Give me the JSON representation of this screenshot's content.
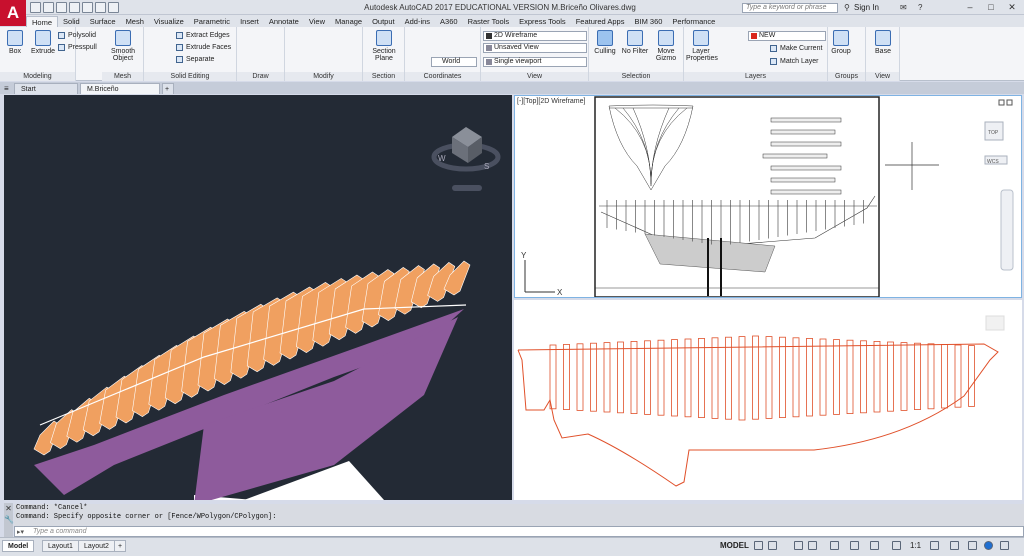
{
  "app": {
    "logo_letter": "A",
    "title": "Autodesk AutoCAD 2017    EDUCATIONAL VERSION    M.Briceño Olivares.dwg",
    "search_placeholder": "Type a keyword or phrase",
    "sign_in": "Sign In"
  },
  "ribbon_tabs": [
    "Home",
    "Solid",
    "Surface",
    "Mesh",
    "Visualize",
    "Parametric",
    "Insert",
    "Annotate",
    "View",
    "Manage",
    "Output",
    "Add-ins",
    "A360",
    "Raster Tools",
    "Express Tools",
    "Featured Apps",
    "BIM 360",
    "Performance"
  ],
  "active_tab": "Home",
  "ribbon": {
    "modeling": {
      "title": "Modeling",
      "box": "Box",
      "extrude": "Extrude",
      "polysolid": "Polysolid",
      "presspull": "Presspull"
    },
    "mesh": {
      "title": "Mesh",
      "smooth_object": "Smooth Object"
    },
    "solid_editing": {
      "title": "Solid Editing",
      "extract_edges": "Extract Edges",
      "extrude_faces": "Extrude Faces",
      "separate": "Separate"
    },
    "draw": {
      "title": "Draw"
    },
    "modify": {
      "title": "Modify"
    },
    "section": {
      "title": "Section",
      "section_plane": "Section Plane"
    },
    "coordinates": {
      "title": "Coordinates",
      "world": "World"
    },
    "view": {
      "title": "View",
      "visual_style": "2D Wireframe",
      "saved_view": "Unsaved View",
      "viewport": "Single viewport"
    },
    "selection": {
      "title": "Selection",
      "culling": "Culling",
      "no_filter": "No Filter",
      "move_gizmo": "Move Gizmo"
    },
    "layers": {
      "title": "Layers",
      "layer_properties": "Layer Properties",
      "current_layer": "NEW",
      "make_current": "Make Current",
      "match_layer": "Match Layer",
      "layer_color": "#d9261c"
    },
    "groups": {
      "title": "Groups",
      "group": "Group"
    },
    "view2": {
      "title": "View",
      "base": "Base"
    }
  },
  "file_tabs": [
    "Start",
    "M.Briceño Olivares*"
  ],
  "viewcube": {
    "w": "W",
    "s": "S"
  },
  "viewport_label": "[-][Top][2D Wireframe]",
  "ucs": {
    "x": "X",
    "y": "Y"
  },
  "navbar": {
    "top": "TOP",
    "wcs": "WCS"
  },
  "command": {
    "history": [
      "Command: *Cancel*",
      "Command: Specify opposite corner or [Fence/WPolygon/CPolygon]:"
    ],
    "placeholder": "Type a command"
  },
  "layout_tabs": [
    "Model",
    "Layout1",
    "Layout2"
  ],
  "status": {
    "model": "MODEL",
    "scale": "1:1"
  },
  "colors": {
    "hull_orange": "#f0a060",
    "hull_purple": "#8e5b9c",
    "section_red": "#e0502a",
    "viewport_dark": "#232a35"
  }
}
